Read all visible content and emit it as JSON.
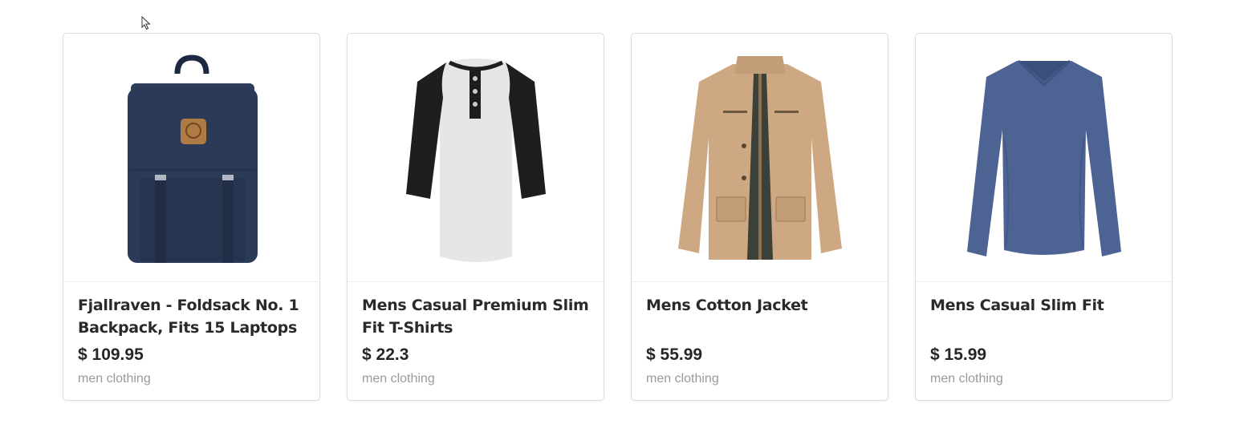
{
  "products": [
    {
      "title": "Fjallraven - Foldsack No. 1 Backpack, Fits 15 Laptops",
      "price": "$ 109.95",
      "category": "men clothing",
      "image_icon": "backpack-image",
      "color": "#2b3a57"
    },
    {
      "title": "Mens Casual Premium Slim Fit T-Shirts",
      "price": "$ 22.3",
      "category": "men clothing",
      "image_icon": "raglan-tshirt-image",
      "color": "#e4e4e4"
    },
    {
      "title": "Mens Cotton Jacket",
      "price": "$ 55.99",
      "category": "men clothing",
      "image_icon": "cotton-jacket-image",
      "color": "#cda882"
    },
    {
      "title": "Mens Casual Slim Fit",
      "price": "$ 15.99",
      "category": "men clothing",
      "image_icon": "long-sleeve-shirt-image",
      "color": "#4d6394"
    }
  ]
}
